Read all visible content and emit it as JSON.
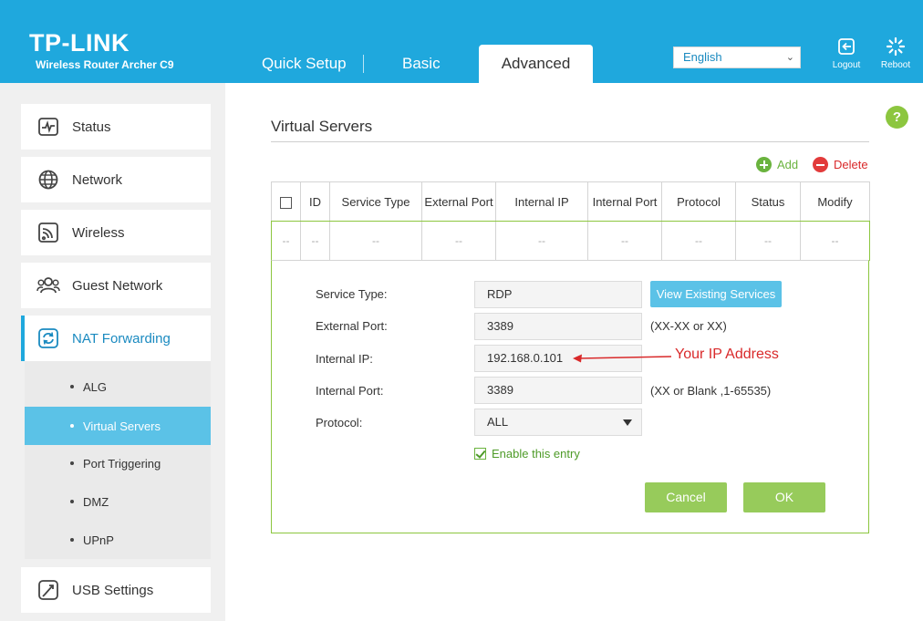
{
  "header": {
    "brand": "TP-LINK",
    "model": "Wireless Router Archer C9",
    "tabs": [
      {
        "label": "Quick Setup"
      },
      {
        "label": "Basic"
      },
      {
        "label": "Advanced"
      }
    ],
    "language": "English",
    "logout_label": "Logout",
    "reboot_label": "Reboot",
    "accent_color": "#1fa8dd"
  },
  "sidebar": {
    "items": [
      {
        "label": "Status",
        "icon": "status-icon"
      },
      {
        "label": "Network",
        "icon": "globe-icon"
      },
      {
        "label": "Wireless",
        "icon": "wireless-icon"
      },
      {
        "label": "Guest Network",
        "icon": "guest-users-icon"
      },
      {
        "label": "NAT Forwarding",
        "icon": "nat-forwarding-icon",
        "active": true
      },
      {
        "label": "USB Settings",
        "icon": "usb-icon"
      }
    ],
    "submenu": [
      {
        "label": "ALG"
      },
      {
        "label": "Virtual Servers",
        "active": true
      },
      {
        "label": "Port Triggering"
      },
      {
        "label": "DMZ"
      },
      {
        "label": "UPnP"
      }
    ]
  },
  "help_label": "?",
  "main": {
    "title": "Virtual Servers",
    "add_label": "Add",
    "delete_label": "Delete",
    "table": {
      "headers": [
        "ID",
        "Service Type",
        "External Port",
        "Internal IP",
        "Internal Port",
        "Protocol",
        "Status",
        "Modify"
      ],
      "empty_cell": "--"
    },
    "form": {
      "service_type_label": "Service Type:",
      "service_type_value": "RDP",
      "view_services_label": "View Existing Services",
      "external_port_label": "External Port:",
      "external_port_value": "3389",
      "external_port_hint": "(XX-XX or XX)",
      "internal_ip_label": "Internal IP:",
      "internal_ip_value": "192.168.0.101",
      "annotation": "Your IP Address",
      "internal_port_label": "Internal Port:",
      "internal_port_value": "3389",
      "internal_port_hint": "(XX or Blank ,1-65535)",
      "protocol_label": "Protocol:",
      "protocol_value": "ALL",
      "enable_label": "Enable this entry",
      "cancel_label": "Cancel",
      "ok_label": "OK"
    }
  }
}
